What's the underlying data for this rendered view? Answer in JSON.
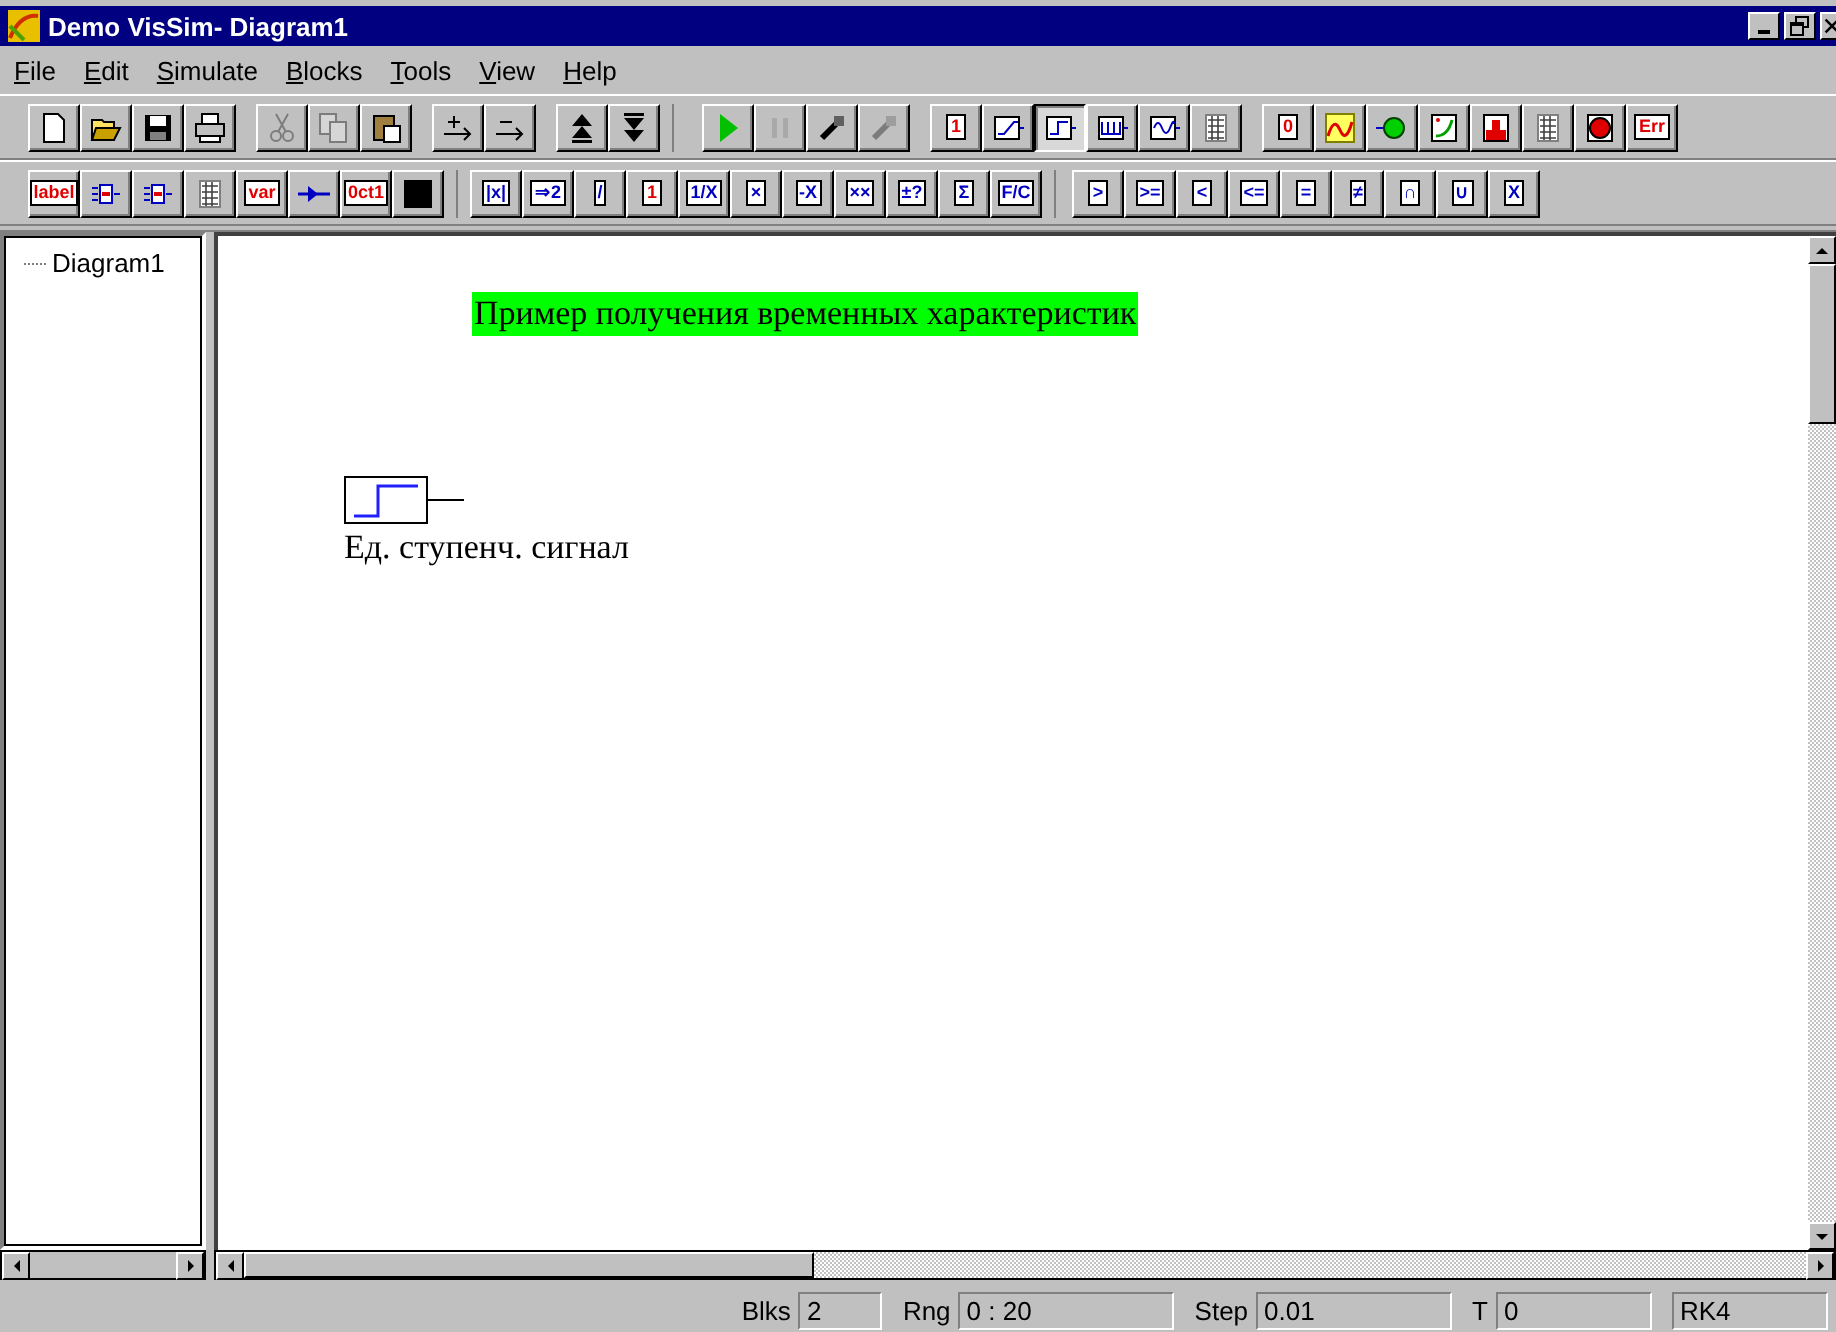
{
  "window": {
    "title": "Demo VisSim- Diagram1"
  },
  "menu": [
    "File",
    "Edit",
    "Simulate",
    "Blocks",
    "Tools",
    "View",
    "Help"
  ],
  "toolbars": [
    [
      [
        {
          "kind": "new",
          "disabled": false,
          "pressed": false
        },
        {
          "kind": "open",
          "disabled": false,
          "pressed": false
        },
        {
          "kind": "save",
          "disabled": false,
          "pressed": false
        },
        {
          "kind": "print",
          "disabled": false,
          "pressed": false
        }
      ],
      [
        {
          "kind": "cut",
          "disabled": true,
          "pressed": false
        },
        {
          "kind": "copy",
          "disabled": true,
          "pressed": false
        },
        {
          "kind": "paste",
          "disabled": false,
          "pressed": false
        }
      ],
      [
        {
          "kind": "add-port",
          "disabled": false,
          "pressed": false
        },
        {
          "kind": "remove-port",
          "disabled": false,
          "pressed": false
        }
      ],
      [
        {
          "kind": "up",
          "disabled": false,
          "pressed": false
        },
        {
          "kind": "down",
          "disabled": false,
          "pressed": false
        }
      ],
      [
        {
          "kind": "play",
          "disabled": false,
          "pressed": false
        },
        {
          "kind": "pause",
          "disabled": true,
          "pressed": false
        },
        {
          "kind": "probe",
          "disabled": false,
          "pressed": false
        },
        {
          "kind": "probe",
          "disabled": true,
          "pressed": false
        }
      ],
      [
        {
          "kind": "text-red",
          "glyph": "1",
          "disabled": false,
          "pressed": false
        },
        {
          "kind": "ramp",
          "disabled": false,
          "pressed": false
        },
        {
          "kind": "step",
          "disabled": false,
          "pressed": true
        },
        {
          "kind": "pulse",
          "disabled": false,
          "pressed": false
        },
        {
          "kind": "sine",
          "disabled": false,
          "pressed": false
        },
        {
          "kind": "grid",
          "disabled": false,
          "pressed": false
        }
      ],
      [
        {
          "kind": "text-red",
          "glyph": "0",
          "disabled": false,
          "pressed": false
        },
        {
          "kind": "plot",
          "disabled": false,
          "pressed": false
        },
        {
          "kind": "light",
          "disabled": false,
          "pressed": false
        },
        {
          "kind": "xy",
          "disabled": false,
          "pressed": false
        },
        {
          "kind": "histogram",
          "disabled": false,
          "pressed": false
        },
        {
          "kind": "grid",
          "disabled": false,
          "pressed": false
        },
        {
          "kind": "stop",
          "disabled": false,
          "pressed": false
        },
        {
          "kind": "text-red",
          "glyph": "Err",
          "disabled": false,
          "pressed": false
        }
      ]
    ],
    [
      [
        {
          "kind": "text-red",
          "glyph": "label",
          "disabled": false,
          "pressed": false
        },
        {
          "kind": "wire-in",
          "disabled": false,
          "pressed": false
        },
        {
          "kind": "wire-out",
          "disabled": false,
          "pressed": false
        },
        {
          "kind": "grid",
          "disabled": false,
          "pressed": false
        },
        {
          "kind": "text-red",
          "glyph": "var",
          "disabled": false,
          "pressed": false
        },
        {
          "kind": "wire",
          "disabled": false,
          "pressed": false
        },
        {
          "kind": "text-red",
          "glyph": "0ct1",
          "disabled": false,
          "pressed": false
        },
        {
          "kind": "swatch",
          "disabled": false,
          "pressed": false
        }
      ],
      [
        {
          "kind": "text-blue",
          "glyph": "|x|",
          "disabled": false,
          "pressed": false
        },
        {
          "kind": "text-blue",
          "glyph": "⇒2",
          "disabled": false,
          "pressed": false
        },
        {
          "kind": "text-blue",
          "glyph": "/",
          "disabled": false,
          "pressed": false
        },
        {
          "kind": "text-red",
          "glyph": "1",
          "disabled": false,
          "pressed": false
        },
        {
          "kind": "text-blue",
          "glyph": "1/X",
          "disabled": false,
          "pressed": false
        },
        {
          "kind": "text-blue",
          "glyph": "×",
          "disabled": false,
          "pressed": false
        },
        {
          "kind": "text-blue",
          "glyph": "-X",
          "disabled": false,
          "pressed": false
        },
        {
          "kind": "text-blue",
          "glyph": "××",
          "disabled": false,
          "pressed": false
        },
        {
          "kind": "text-blue",
          "glyph": "±?",
          "disabled": false,
          "pressed": false
        },
        {
          "kind": "text-blue",
          "glyph": "Σ",
          "disabled": false,
          "pressed": false
        },
        {
          "kind": "text-blue",
          "glyph": "F/C",
          "disabled": false,
          "pressed": false
        }
      ],
      [
        {
          "kind": "text-blue",
          "glyph": ">",
          "disabled": false,
          "pressed": false
        },
        {
          "kind": "text-blue",
          "glyph": ">=",
          "disabled": false,
          "pressed": false
        },
        {
          "kind": "text-blue",
          "glyph": "<",
          "disabled": false,
          "pressed": false
        },
        {
          "kind": "text-blue",
          "glyph": "<=",
          "disabled": false,
          "pressed": false
        },
        {
          "kind": "text-blue",
          "glyph": "=",
          "disabled": false,
          "pressed": false
        },
        {
          "kind": "text-blue",
          "glyph": "≠",
          "disabled": false,
          "pressed": false
        },
        {
          "kind": "text-blue",
          "glyph": "∩",
          "disabled": false,
          "pressed": false
        },
        {
          "kind": "text-blue",
          "glyph": "∪",
          "disabled": false,
          "pressed": false
        },
        {
          "kind": "text-blue",
          "glyph": "X",
          "disabled": false,
          "pressed": false
        }
      ]
    ]
  ],
  "tree": {
    "items": [
      {
        "label": "Diagram1"
      }
    ]
  },
  "canvas": {
    "title": "Пример получения временных характеристик",
    "blocks": [
      {
        "kind": "step",
        "label": "Ед. ступенч. сигнал"
      }
    ]
  },
  "status_bar": [
    {
      "label": "Blks",
      "value": "2"
    },
    {
      "label": "Rng",
      "value": "0 : 20"
    },
    {
      "label": "Step",
      "value": "0.01"
    },
    {
      "label": "T",
      "value": "0"
    },
    {
      "value": "RK4"
    }
  ]
}
